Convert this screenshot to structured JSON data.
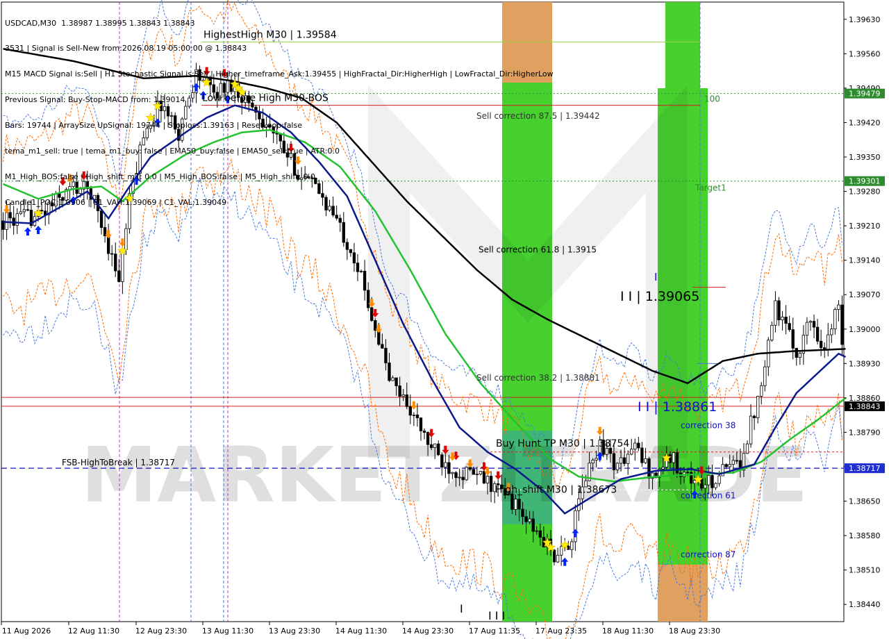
{
  "symbol_line": "USDCAD,M30  1.38987 1.38995 1.38843 1.38843",
  "info_lines": [
    "3531 | Signal is Sell-New from:2026.08.19 05:00:00 @ 1.38843",
    "M15 MACD Signal is:Sell | H1 Stochastic Signal is:Sell | Higher_timeframe_Ask:1.39455 | HighFractal_Dir:HigherHigh | LowFractal_Dir:HigherLow",
    "Previous Signal: Buy-Stop-MACD from: 1.39014",
    "Bars: 19744 | ArraySize UpSignal: 19744 | Stoploss:1.39163 | ResetLoop:false",
    "tema_m1_sell: true | tema_m1_buy: false | EMA50_buy:false | EMA50_sell:true | ATR:0.0",
    "M1_High_BOS:false | High_shift_m1: 0.0 | M5_High_BOS:false | M5_High_shift: 0.0",
    "Candle1_POC:1.3906 | C1_VAH:1.39069 | C1_VAL:1.39049"
  ],
  "watermark": "MARKETZITRADE",
  "colors": {
    "bg": "#ffffff",
    "bull_candle": "#000000",
    "bear_candle": "#000000",
    "ema_navy": "#0a1a8c",
    "ema_green": "#22c32e",
    "ma_black": "#000000",
    "zone_green": "#47d12f",
    "zone_orange": "#e0a060",
    "dash_blue": "#1010c8",
    "level_red": "#d02020",
    "level_green": "#2e8b2e",
    "orange_env": "#ff6a00",
    "blue_env": "#4a7ad8",
    "arrow_up": "#0026ff",
    "arrow_down": "#e00000",
    "arrow_orange": "#ff8c00",
    "star": "#ffee00",
    "price_box": "#000000",
    "label_green_box": "#2e8b2e",
    "label_blue_box": "#1f2fd0"
  },
  "chart_data": {
    "type": "candlestick",
    "title": "USDCAD,M30",
    "ylim": [
      1.38405,
      1.39665
    ],
    "price_ticks": [
      "1.39630",
      "1.39560",
      "1.39490",
      "1.39420",
      "1.39350",
      "1.39280",
      "1.39210",
      "1.39140",
      "1.39070",
      "1.39000",
      "1.38930",
      "1.38860",
      "1.38790",
      "1.38720",
      "1.38650",
      "1.38580",
      "1.38510",
      "1.38440"
    ],
    "time_ticks": [
      "11 Aug 2026",
      "12 Aug 11:30",
      "12 Aug 23:30",
      "13 Aug 11:30",
      "13 Aug 23:30",
      "14 Aug 11:30",
      "14 Aug 23:30",
      "17 Aug 11:35",
      "17 Aug 23:35",
      "18 Aug 11:30",
      "18 Aug 23:30"
    ],
    "bar_count": 240,
    "close_path": [
      [
        0,
        1.3922
      ],
      [
        10,
        1.3923
      ],
      [
        20,
        1.3929
      ],
      [
        25,
        1.3928
      ],
      [
        30,
        1.3917
      ],
      [
        33,
        1.391
      ],
      [
        36,
        1.3926
      ],
      [
        40,
        1.394
      ],
      [
        45,
        1.3946
      ],
      [
        50,
        1.394
      ],
      [
        55,
        1.3952
      ],
      [
        60,
        1.3948
      ],
      [
        65,
        1.395
      ],
      [
        70,
        1.3946
      ],
      [
        75,
        1.3942
      ],
      [
        80,
        1.3936
      ],
      [
        85,
        1.3931
      ],
      [
        90,
        1.3928
      ],
      [
        95,
        1.3922
      ],
      [
        100,
        1.3915
      ],
      [
        105,
        1.3903
      ],
      [
        110,
        1.389
      ],
      [
        115,
        1.3885
      ],
      [
        120,
        1.3878
      ],
      [
        125,
        1.3873
      ],
      [
        130,
        1.3871
      ],
      [
        135,
        1.387
      ],
      [
        140,
        1.3868
      ],
      [
        145,
        1.3865
      ],
      [
        150,
        1.386
      ],
      [
        155,
        1.3856
      ],
      [
        158,
        1.3853
      ],
      [
        162,
        1.3858
      ],
      [
        165,
        1.3868
      ],
      [
        170,
        1.3877
      ],
      [
        175,
        1.3872
      ],
      [
        180,
        1.3876
      ],
      [
        185,
        1.387
      ],
      [
        190,
        1.3874
      ],
      [
        195,
        1.387
      ],
      [
        200,
        1.3868
      ],
      [
        205,
        1.3871
      ],
      [
        210,
        1.3873
      ],
      [
        215,
        1.3886
      ],
      [
        218,
        1.3898
      ],
      [
        220,
        1.3905
      ],
      [
        223,
        1.39
      ],
      [
        226,
        1.3895
      ],
      [
        230,
        1.3902
      ],
      [
        234,
        1.3896
      ],
      [
        236,
        1.39
      ],
      [
        238,
        1.3906
      ],
      [
        240,
        1.389
      ],
      [
        241,
        1.3884
      ]
    ],
    "ema_fast_navy": [
      [
        0,
        1.39218
      ],
      [
        8,
        1.39215
      ],
      [
        18,
        1.39255
      ],
      [
        24,
        1.3928
      ],
      [
        30,
        1.39225
      ],
      [
        36,
        1.3929
      ],
      [
        42,
        1.3935
      ],
      [
        50,
        1.3939
      ],
      [
        58,
        1.3943
      ],
      [
        66,
        1.39455
      ],
      [
        74,
        1.3944
      ],
      [
        82,
        1.394
      ],
      [
        90,
        1.3934
      ],
      [
        98,
        1.3927
      ],
      [
        106,
        1.3914
      ],
      [
        114,
        1.3901
      ],
      [
        122,
        1.389
      ],
      [
        130,
        1.388
      ],
      [
        138,
        1.3875
      ],
      [
        146,
        1.38715
      ],
      [
        154,
        1.3867
      ],
      [
        160,
        1.38625
      ],
      [
        168,
        1.3866
      ],
      [
        176,
        1.38695
      ],
      [
        186,
        1.38712
      ],
      [
        196,
        1.38715
      ],
      [
        204,
        1.38705
      ],
      [
        214,
        1.38725
      ],
      [
        220,
        1.388
      ],
      [
        226,
        1.3887
      ],
      [
        232,
        1.3891
      ],
      [
        238,
        1.3895
      ],
      [
        241,
        1.3894
      ]
    ],
    "ema_slow_green": [
      [
        0,
        1.39295
      ],
      [
        10,
        1.39265
      ],
      [
        20,
        1.39285
      ],
      [
        28,
        1.3929
      ],
      [
        34,
        1.3926
      ],
      [
        42,
        1.3931
      ],
      [
        52,
        1.39355
      ],
      [
        60,
        1.3938
      ],
      [
        68,
        1.394
      ],
      [
        76,
        1.39405
      ],
      [
        86,
        1.3938
      ],
      [
        96,
        1.3933
      ],
      [
        106,
        1.3924
      ],
      [
        116,
        1.3912
      ],
      [
        126,
        1.3899
      ],
      [
        136,
        1.3889
      ],
      [
        146,
        1.3881
      ],
      [
        156,
        1.38735
      ],
      [
        164,
        1.387
      ],
      [
        174,
        1.3869
      ],
      [
        186,
        1.387
      ],
      [
        198,
        1.38705
      ],
      [
        208,
        1.38708
      ],
      [
        216,
        1.3873
      ],
      [
        224,
        1.38775
      ],
      [
        232,
        1.38815
      ],
      [
        240,
        1.3886
      ],
      [
        241,
        1.3887
      ]
    ],
    "ma_black_path": [
      [
        0,
        1.3957
      ],
      [
        20,
        1.39545
      ],
      [
        40,
        1.3951
      ],
      [
        55,
        1.39515
      ],
      [
        65,
        1.39505
      ],
      [
        75,
        1.3949
      ],
      [
        85,
        1.3947
      ],
      [
        95,
        1.3942
      ],
      [
        105,
        1.3934
      ],
      [
        115,
        1.3926
      ],
      [
        125,
        1.3919
      ],
      [
        135,
        1.3912
      ],
      [
        145,
        1.3906
      ],
      [
        155,
        1.3902
      ],
      [
        165,
        1.38985
      ],
      [
        175,
        1.3895
      ],
      [
        185,
        1.38915
      ],
      [
        195,
        1.3889
      ],
      [
        205,
        1.38935
      ],
      [
        215,
        1.3895
      ],
      [
        225,
        1.38955
      ],
      [
        235,
        1.38958
      ],
      [
        241,
        1.3896
      ]
    ],
    "levels": [
      {
        "label": "HighestHigh   M30 | 1.39584",
        "price": 1.39584,
        "color": "green",
        "style": "solid"
      },
      {
        "label": "100",
        "price": 1.39479,
        "color": "green",
        "style": "dotted"
      },
      {
        "label": "Low before High   M30-BOS",
        "price": 1.39455,
        "color": "red",
        "style": "solid"
      },
      {
        "label": "Sell correction 87.5 | 1.39442",
        "price": 1.39442,
        "color": "none",
        "style": "none"
      },
      {
        "label": "Target1",
        "price": 1.39301,
        "color": "green",
        "style": "dotted"
      },
      {
        "label": "Sell correction 61.8 | 1.3915",
        "price": 1.3915,
        "color": "none",
        "style": "none"
      },
      {
        "label": "I I | 1.39065",
        "price": 1.39065,
        "color": "black",
        "style": "label"
      },
      {
        "label": "Sell correction 38.2 | 1.38881",
        "price": 1.38881,
        "color": "none",
        "style": "none"
      },
      {
        "label": "I I | 1.38861",
        "price": 1.38861,
        "color": "blue",
        "style": "label"
      },
      {
        "label": "correction 38",
        "price": 1.38832,
        "color": "blue",
        "style": "label"
      },
      {
        "label": "Buy Hunt TP M30 | 1.38754",
        "price": 1.38754,
        "color": "black",
        "style": "label"
      },
      {
        "label": "FSB-HighToBreak | 1.38717",
        "price": 1.38717,
        "color": "blue",
        "style": "dashed"
      },
      {
        "label": "High_shift M30 | 1.38673",
        "price": 1.38673,
        "color": "black",
        "style": "label"
      },
      {
        "label": "correction 61",
        "price": 1.38673,
        "color": "blue",
        "style": "label"
      },
      {
        "label": "correction 87",
        "price": 1.3853,
        "color": "blue",
        "style": "label"
      }
    ],
    "price_labels": [
      {
        "text": "1.39479",
        "price": 1.39479,
        "color": "green"
      },
      {
        "text": "1.39301",
        "price": 1.39301,
        "color": "green"
      },
      {
        "text": "1.38843",
        "price": 1.38843,
        "color": "black"
      },
      {
        "text": "1.38717",
        "price": 1.38717,
        "color": "blue"
      }
    ],
    "bottom_marks": [
      "I",
      "I I I"
    ]
  }
}
